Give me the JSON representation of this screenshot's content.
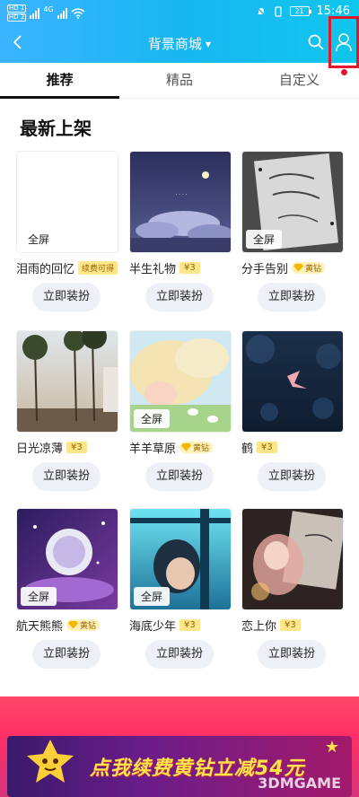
{
  "status_bar": {
    "sim1": "HD 1",
    "sim2": "HD 2",
    "network": "4G",
    "battery": "21",
    "time": "15:46"
  },
  "header": {
    "title": "背景商城",
    "icons": [
      "back-icon",
      "search-icon",
      "user-icon",
      "dropdown-caret-icon"
    ],
    "accent_color": "#19b6f2"
  },
  "tabs": [
    {
      "label": "推荐",
      "active": true
    },
    {
      "label": "精品",
      "active": false
    },
    {
      "label": "自定义",
      "active": false
    }
  ],
  "section": {
    "title": "最新上架"
  },
  "button_label": "立即装扮",
  "full_screen_badge": "全屏",
  "items": [
    {
      "name": "泪雨的回忆",
      "tag": "续费可得",
      "tag_type": "free",
      "full_screen": true
    },
    {
      "name": "半生礼物",
      "tag": "¥3",
      "tag_type": "price",
      "full_screen": false
    },
    {
      "name": "分手告别",
      "tag": "黄钻",
      "tag_type": "vip",
      "full_screen": true
    },
    {
      "name": "日光凉薄",
      "tag": "¥3",
      "tag_type": "price",
      "full_screen": false
    },
    {
      "name": "羊羊草原",
      "tag": "黄钻",
      "tag_type": "vip",
      "full_screen": true
    },
    {
      "name": "鹤",
      "tag": "¥3",
      "tag_type": "price",
      "full_screen": false
    },
    {
      "name": "航天熊熊",
      "tag": "黄钻",
      "tag_type": "vip",
      "full_screen": true
    },
    {
      "name": "海底少年",
      "tag": "¥3",
      "tag_type": "price",
      "full_screen": true
    },
    {
      "name": "恋上你",
      "tag": "¥3",
      "tag_type": "price",
      "full_screen": false
    }
  ],
  "banner": {
    "text": "点我续费黄钻立减54元",
    "watermark": "3DMGAME"
  }
}
